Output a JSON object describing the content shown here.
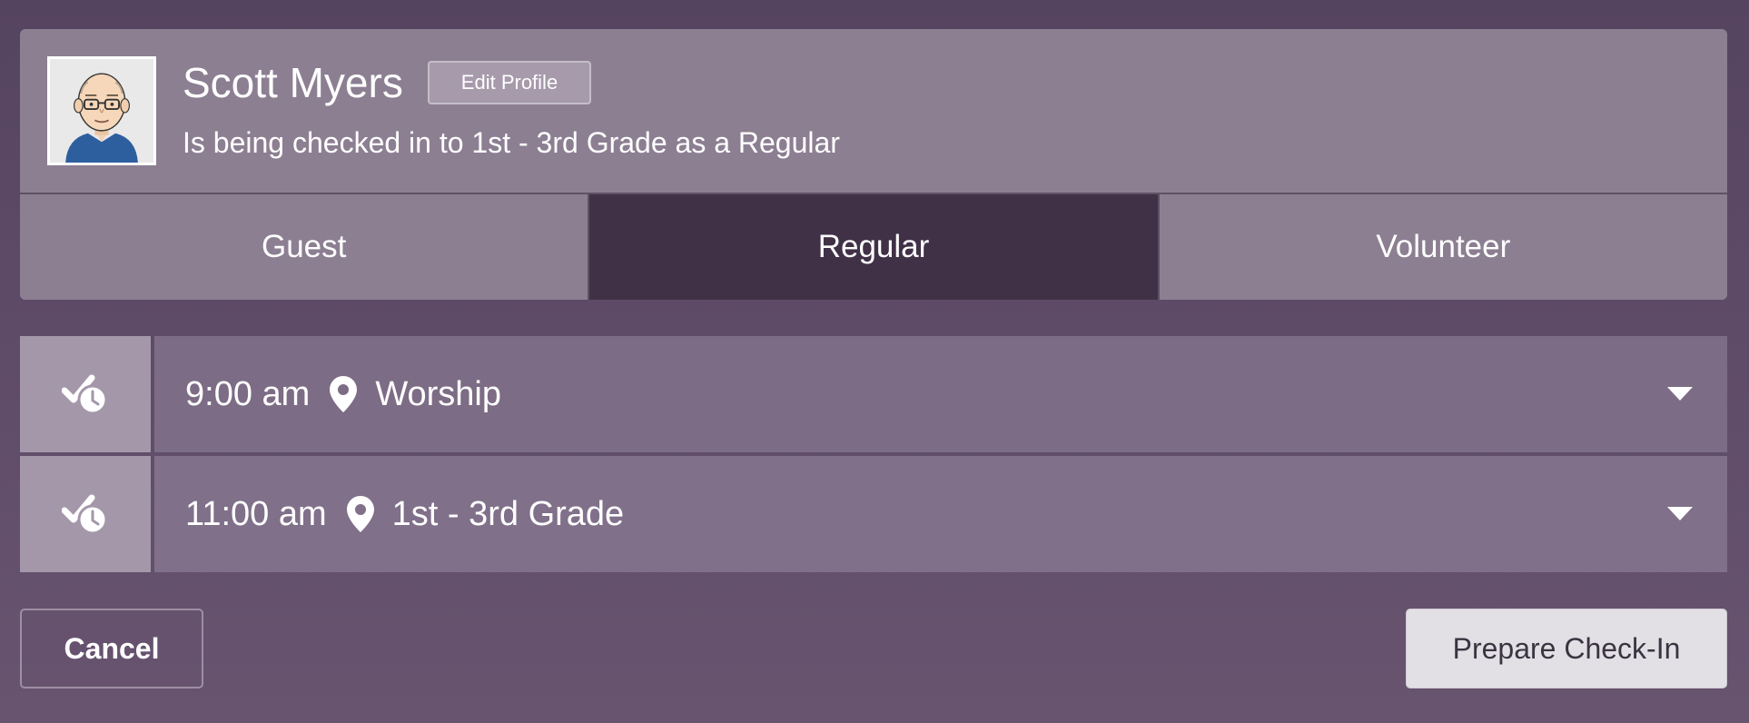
{
  "profile": {
    "name": "Scott Myers",
    "edit_label": "Edit Profile",
    "status_text": "Is being checked in to 1st - 3rd Grade as a Regular"
  },
  "tabs": [
    {
      "label": "Guest",
      "active": false
    },
    {
      "label": "Regular",
      "active": true
    },
    {
      "label": "Volunteer",
      "active": false
    }
  ],
  "sessions": [
    {
      "time": "9:00 am",
      "location": "Worship",
      "icon": "check-clock-icon"
    },
    {
      "time": "11:00 am",
      "location": "1st - 3rd Grade",
      "icon": "check-clock-icon"
    }
  ],
  "actions": {
    "cancel_label": "Cancel",
    "prepare_label": "Prepare Check-In"
  },
  "colors": {
    "background": "#5e4b68",
    "card": "#8c7f92",
    "active_tab": "#413147",
    "session_row": "#7d6c85",
    "session_icon_cell": "#a497aa",
    "primary_button": "#e2dfe5"
  }
}
